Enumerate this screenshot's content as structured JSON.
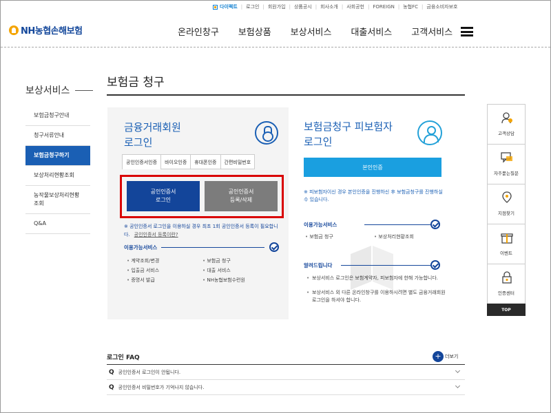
{
  "utility": {
    "direct": "다이렉트",
    "links": [
      "로그인",
      "회원가입",
      "상품공시",
      "회사소개",
      "사회공헌",
      "FOREIGN",
      "농협FC",
      "금융소비자보호"
    ]
  },
  "logo": {
    "text": "NH농협손해보험"
  },
  "gnb": [
    "온라인창구",
    "보험상품",
    "보상서비스",
    "대출서비스",
    "고객서비스"
  ],
  "lnb": {
    "title": "보상서비스",
    "items": [
      "보험금청구안내",
      "청구서류안내",
      "보험금청구하기",
      "보상처리현황조회",
      "농작물보상처리현황조회",
      "Q&A"
    ],
    "active_index": 2
  },
  "page": {
    "title": "보험금 청구"
  },
  "member_login": {
    "title_line1": "금융거래회원",
    "title_line2": "로그인",
    "tabs": [
      "공인인증서인증",
      "바이오인증",
      "휴대폰인증",
      "간편비밀번호"
    ],
    "btn_login_line1": "공인인증서",
    "btn_login_line2": "로그인",
    "btn_reg_line1": "공인인증서",
    "btn_reg_line2": "등록/삭제",
    "notice": "※ 공인인증서 로그인을 이용하실 경우 최초 1회 공인인증서 등록이 필요합니다.",
    "notice_link": "공인인증서 등록이란?",
    "services_title": "이용가능서비스",
    "services": [
      "계약조회/변경",
      "보험금 청구",
      "입출금 서비스",
      "대출 서비스",
      "증명서 발급",
      "NH농협보험수련원"
    ]
  },
  "insured_login": {
    "title_line1": "보험금청구 피보험자",
    "title_line2": "로그인",
    "button": "본인인증",
    "notice": "※ 피보험자이신 경우 본인인증을 진행하신 후 보험금청구를 진행하실 수 있습니다.",
    "services_title": "이용가능서비스",
    "services": [
      "보험금 청구",
      "보상처리현황조회"
    ],
    "alert_title": "알려드립니다",
    "alerts": [
      "보상서비스 로그인은 보험계약자, 피보험자에 한해 가능합니다.",
      "보상서비스 외 다른 온라인창구를 이용하시려면 별도 금융거래회원 로그인을 하셔야 합니다."
    ]
  },
  "quick": {
    "items": [
      {
        "label": "고객상담",
        "icon": "consult-icon"
      },
      {
        "label": "자주묻는질문",
        "icon": "faq-chat-icon"
      },
      {
        "label": "지점찾기",
        "icon": "map-pin-icon"
      },
      {
        "label": "이벤트",
        "icon": "gift-icon"
      },
      {
        "label": "인증센터",
        "icon": "certificate-lock-icon"
      }
    ],
    "top": "TOP"
  },
  "faq": {
    "title": "로그인 FAQ",
    "more": "더보기",
    "items": [
      "공인인증서 로그인이 안됩니다.",
      "공인인증서 비밀번호가 기억나지 않습니다."
    ]
  },
  "colors": {
    "primary": "#13459a",
    "accent": "#1a9fe0",
    "highlight": "#d90000"
  }
}
